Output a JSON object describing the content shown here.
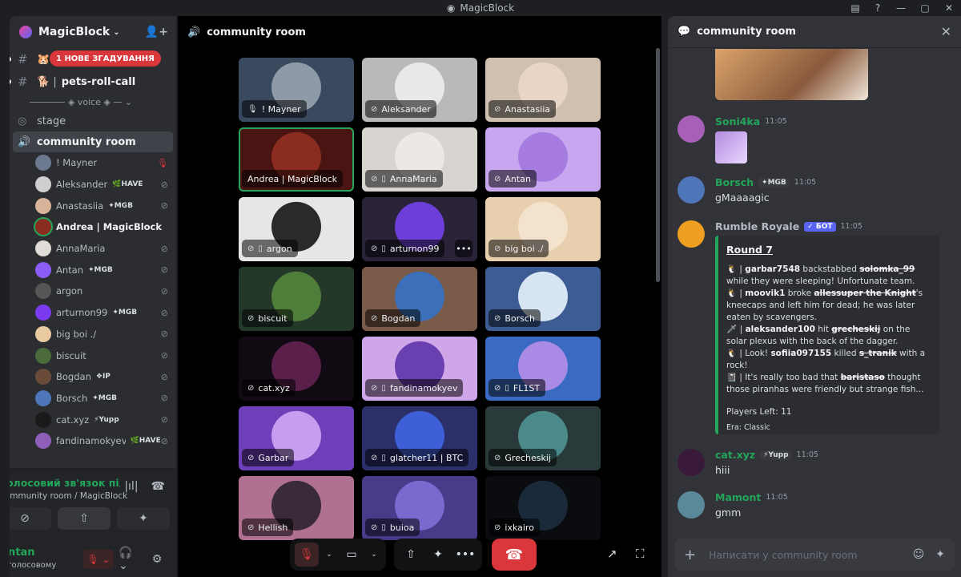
{
  "app": {
    "title": "MagicBlock"
  },
  "server": {
    "name": "MagicBlock"
  },
  "channels": [
    {
      "name": "",
      "mention": "1 НОВЕ ЗГАДУВАННЯ",
      "emoji": "🐹"
    },
    {
      "name": "pets-roll-call",
      "emoji": "🐕 |"
    }
  ],
  "voice_category": "◈ voice ◈",
  "voice_channels": [
    {
      "name": "stage"
    },
    {
      "name": "community room"
    }
  ],
  "voice_users": [
    {
      "name": "! Mayner",
      "tag": "",
      "mic": "🎙",
      "color": "#6b7a8f",
      "speaking": false,
      "muted_red": true
    },
    {
      "name": "Aleksander",
      "tag": "🌿HAVE",
      "mic": "⊘",
      "color": "#cfcfcf",
      "speaking": false
    },
    {
      "name": "Anastasiia",
      "tag": "✦MGB",
      "mic": "⊘",
      "color": "#d9b39a",
      "speaking": false
    },
    {
      "name": "Andrea | MagicBlock",
      "tag": "",
      "mic": "",
      "color": "#8a2c1f",
      "speaking": true
    },
    {
      "name": "AnnaMaria",
      "tag": "",
      "mic": "⊘",
      "color": "#e0ddd9",
      "speaking": false
    },
    {
      "name": "Antan",
      "tag": "✦MGB",
      "mic": "⊘",
      "color": "#8b5cf6",
      "speaking": false
    },
    {
      "name": "argon",
      "tag": "",
      "mic": "⊘",
      "color": "#555555",
      "speaking": false
    },
    {
      "name": "arturnon99",
      "tag": "✦MGB",
      "mic": "⊘",
      "color": "#7c3aed",
      "speaking": false
    },
    {
      "name": "big boi ./",
      "tag": "",
      "mic": "⊘",
      "color": "#e9c9a0",
      "speaking": false
    },
    {
      "name": "biscuit",
      "tag": "",
      "mic": "⊘",
      "color": "#4b6b3a",
      "speaking": false
    },
    {
      "name": "Bogdan",
      "tag": "❖IP",
      "mic": "⊘",
      "color": "#6b4a3a",
      "speaking": false
    },
    {
      "name": "Borsch",
      "tag": "✦MGB",
      "mic": "⊘",
      "color": "#4f76b8",
      "speaking": false
    },
    {
      "name": "cat.xyz",
      "tag": "⚡Yupp",
      "mic": "⊘",
      "color": "#1a1a1a",
      "speaking": false
    },
    {
      "name": "fandinamokyev",
      "tag": "🌿HAVE",
      "mic": "⊘",
      "color": "#8d5fb8",
      "speaking": false
    }
  ],
  "voice_panel": {
    "status": "Голосовий зв'язок підкл",
    "sub": "community room / MagicBlock"
  },
  "user_panel": {
    "name": "Antan",
    "status": "У голосовому"
  },
  "stage": {
    "title": "community room"
  },
  "tiles": [
    {
      "name": "! Mayner",
      "icon": "🎙",
      "device": "",
      "bg": "#3a4a5e",
      "portrait": "#8e9aa8",
      "speaking": false
    },
    {
      "name": "Aleksander",
      "icon": "⊘",
      "device": "",
      "bg": "#b9b9b9",
      "portrait": "#e8e8e8",
      "speaking": false
    },
    {
      "name": "Anastasiia",
      "icon": "⊘",
      "device": "",
      "bg": "#cfc0b0",
      "portrait": "#e8d5c5",
      "speaking": false
    },
    {
      "name": "Andrea | MagicBlock",
      "icon": "",
      "device": "",
      "bg": "#4a1412",
      "portrait": "#8a2c1f",
      "speaking": true
    },
    {
      "name": "AnnaMaria",
      "icon": "⊘",
      "device": "▯",
      "bg": "#d8d4d0",
      "portrait": "#ece8e4",
      "speaking": false
    },
    {
      "name": "Antan",
      "icon": "⊘",
      "device": "",
      "bg": "#c8a7f0",
      "portrait": "#a67ce0",
      "speaking": false
    },
    {
      "name": "argon",
      "icon": "⊘",
      "device": "▯",
      "bg": "#e6e6e6",
      "portrait": "#2a2a2a",
      "speaking": false
    },
    {
      "name": "arturnon99",
      "icon": "⊘",
      "device": "▯",
      "bg": "#2a2238",
      "portrait": "#6d3fd8",
      "speaking": false,
      "more": "•••"
    },
    {
      "name": "big boi ./",
      "icon": "⊘",
      "device": "",
      "bg": "#e8cfae",
      "portrait": "#f3e3cc",
      "speaking": false
    },
    {
      "name": "biscuit",
      "icon": "⊘",
      "device": "",
      "bg": "#24382a",
      "portrait": "#4f7d3a",
      "speaking": false
    },
    {
      "name": "Bogdan",
      "icon": "⊘",
      "device": "",
      "bg": "#7a5a48",
      "portrait": "#3b6fb8",
      "speaking": false
    },
    {
      "name": "Borsch",
      "icon": "⊘",
      "device": "",
      "bg": "#3e5c94",
      "portrait": "#d7e4f2",
      "speaking": false
    },
    {
      "name": "cat.xyz",
      "icon": "⊘",
      "device": "",
      "bg": "#120a12",
      "portrait": "#5a1f4a",
      "speaking": false
    },
    {
      "name": "fandinamokyev",
      "icon": "⊘",
      "device": "▯",
      "bg": "#cfa6e8",
      "portrait": "#6a3fb0",
      "speaking": false
    },
    {
      "name": "FL1ST",
      "icon": "⊘",
      "device": "▯",
      "bg": "#3a6ac2",
      "portrait": "#a98be6",
      "speaking": false
    },
    {
      "name": "Garbar",
      "icon": "⊘",
      "device": "",
      "bg": "#6d3fb8",
      "portrait": "#c79df0",
      "speaking": false
    },
    {
      "name": "glatcher11 | BTC",
      "icon": "⊘",
      "device": "▯",
      "bg": "#2b2f6a",
      "portrait": "#3f5fd8",
      "speaking": false
    },
    {
      "name": "Grecheskij",
      "icon": "⊘",
      "device": "",
      "bg": "#2a3a3a",
      "portrait": "#4a8a8a",
      "speaking": false
    },
    {
      "name": "Hellish",
      "icon": "⊘",
      "device": "",
      "bg": "#b07090",
      "portrait": "#3a2a3a",
      "speaking": false
    },
    {
      "name": "buioa",
      "icon": "⊘",
      "device": "▯",
      "bg": "#4a3a8a",
      "portrait": "#7a6ad0",
      "speaking": false
    },
    {
      "name": "ixkairo",
      "icon": "⊘",
      "device": "",
      "bg": "#0a0c10",
      "portrait": "#1a2a3a",
      "speaking": false
    }
  ],
  "controls": {
    "mic": "🎙",
    "camera": "▭",
    "share": "⇧",
    "activity": "✦",
    "more": "•••",
    "hangup": "☎",
    "popout": "↗",
    "fullscreen": "⛶"
  },
  "chat": {
    "title": "community room",
    "messages": [
      {
        "author": "Soni4ka",
        "color": "#23a55a",
        "time": "11:05",
        "text": "",
        "avatar": "#a85fb8"
      },
      {
        "author": "Borsch",
        "color": "#23a55a",
        "tag": "✦MGB",
        "time": "11:05",
        "text": "gMaaaagic",
        "avatar": "#4f76b8"
      },
      {
        "author": "Rumble Royale",
        "color": "#b5bac1",
        "bot": "✓ БОТ",
        "time": "11:05",
        "avatar": "#f0a020"
      },
      {
        "author": "cat.xyz",
        "color": "#23a55a",
        "tag": "⚡Yupp",
        "time": "11:05",
        "text": "hiii",
        "avatar": "#3a1a3a"
      },
      {
        "author": "Mamont",
        "color": "#23a55a",
        "time": "11:05",
        "text": "gmm",
        "avatar": "#5a8a9a"
      }
    ],
    "embed": {
      "title": "Round 7",
      "players_left": "Players Left: 11",
      "era": "Era: Classic",
      "lines": [
        {
          "icon": "🐧",
          "a": "garbar7548",
          "mid": " backstabbed ",
          "b": "solomka_99",
          "rest": " while they were sleeping! Unfortunate team."
        },
        {
          "icon": "🐧",
          "a": "moovik1",
          "mid": " broke ",
          "b": "allessuper the Knight",
          "rest": "'s kneecaps and left him for dead; he was later eaten by scavengers."
        },
        {
          "icon": "🗡",
          "a": "aleksander100",
          "mid": " hit ",
          "b": "grecheskij",
          "rest": " on the solar plexus with the back of the dagger."
        },
        {
          "icon": "🐧",
          "pre": " | Look! ",
          "a": "sofiia097155",
          "mid": " killed ",
          "b": "s_tranik",
          "rest": " with a rock!"
        },
        {
          "icon": "📓",
          "pre": " | It's really too bad that ",
          "b": "baristaso",
          "rest": " thought those piranhas were friendly but strange fish..."
        }
      ]
    },
    "input_placeholder": "Написати у community room"
  }
}
